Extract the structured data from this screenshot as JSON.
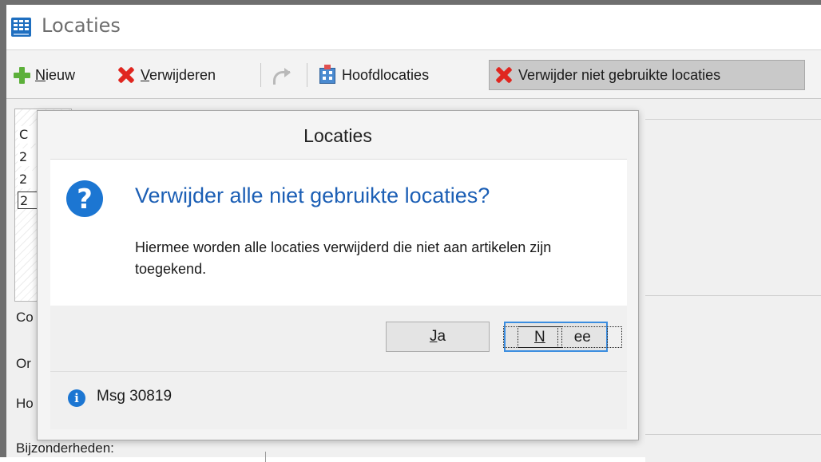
{
  "window": {
    "title": "Locaties",
    "icon": "grid-app-icon"
  },
  "toolbar": {
    "new_prefix": "",
    "new_hotkey": "N",
    "new_rest": "ieuw",
    "delete_hotkey": "V",
    "delete_rest": "erwijderen",
    "main_locations": "Hoofdlocaties",
    "delete_unused": "Verwijder niet gebruikte locaties",
    "icons": [
      "plus-icon",
      "x-icon",
      "undo-icon",
      "building-icon",
      "x-icon"
    ]
  },
  "background_form": {
    "grid_cells": [
      "C",
      "2",
      "2",
      "2"
    ],
    "labels": [
      "Co",
      "Or",
      "Ho",
      "Bijzonderheden:"
    ]
  },
  "dialog": {
    "title": "Locaties",
    "heading": "Verwijder alle niet gebruikte locaties?",
    "body": "Hiermee worden alle locaties verwijderd die niet aan artikelen zijn toegekend.",
    "buttons": {
      "yes_hotkey": "J",
      "yes_rest": "a",
      "no_hotkey": "N",
      "no_rest": "ee"
    },
    "footer_text": "Msg 30819",
    "colors": {
      "heading": "#1c5fb5",
      "icon": "#1c76d2"
    }
  }
}
